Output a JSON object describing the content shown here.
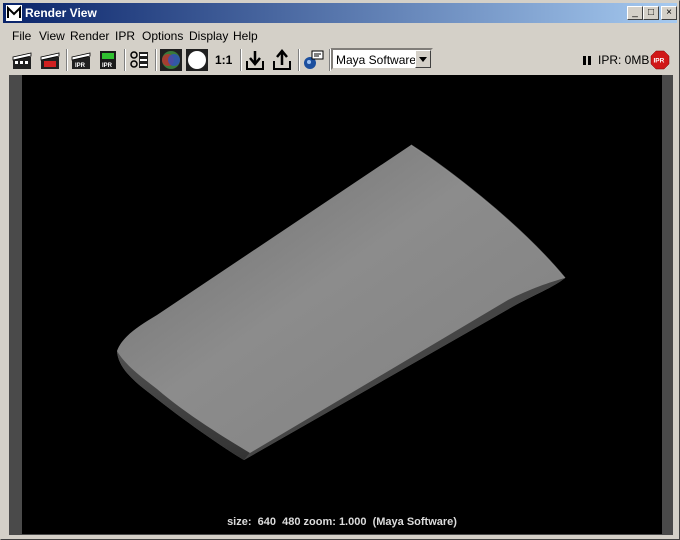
{
  "window": {
    "title": "Render View",
    "minimize_glyph": "_",
    "maximize_glyph": "□",
    "close_glyph": "×"
  },
  "menu": [
    "File",
    "View",
    "Render",
    "IPR",
    "Options",
    "Display",
    "Help"
  ],
  "toolbar": {
    "icons": [
      "render-current-frame-icon",
      "redo-previous-render-icon",
      "ipr-render-icon",
      "refresh-ipr-icon",
      "render-region-icon",
      "display-rgb-channels-icon",
      "display-alpha-channel-icon",
      "keep-image-icon",
      "remove-image-icon",
      "render-settings-icon"
    ],
    "ratio_label": "1:1",
    "renderer": "Maya Software",
    "ipr_status": "IPR: 0MB"
  },
  "render": {
    "status": "size:  640  480 zoom: 1.000  (Maya Software)"
  }
}
